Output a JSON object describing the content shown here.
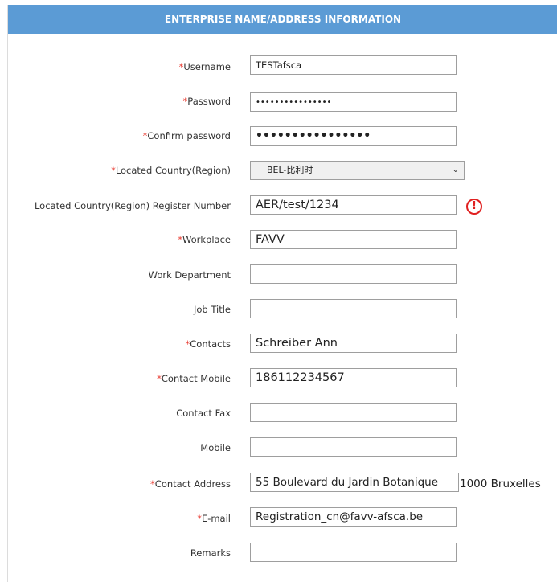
{
  "header": {
    "title": "ENTERPRISE NAME/ADDRESS INFORMATION"
  },
  "fields": {
    "username": {
      "label": "Username",
      "value": "TESTafsca"
    },
    "password": {
      "label": "Password",
      "value": "••••••••••••••••"
    },
    "confirm_password": {
      "label": "Confirm password",
      "value": "••••••••••••••••"
    },
    "country": {
      "label": "Located Country(Region)",
      "value": "BEL-比利时"
    },
    "register_number": {
      "label": "Located Country(Region) Register Number",
      "value": "AER/test/1234"
    },
    "workplace": {
      "label": "Workplace",
      "value": "FAVV"
    },
    "work_department": {
      "label": "Work Department",
      "value": ""
    },
    "job_title": {
      "label": "Job Title",
      "value": ""
    },
    "contacts": {
      "label": "Contacts",
      "value": "Schreiber Ann"
    },
    "contact_mobile": {
      "label": "Contact Mobile",
      "value": "186112234567"
    },
    "contact_fax": {
      "label": "Contact Fax",
      "value": ""
    },
    "mobile": {
      "label": "Mobile",
      "value": ""
    },
    "contact_address": {
      "label": "Contact Address",
      "value": "55 Boulevard du Jardin Botanique",
      "overflow": "1000 Bruxelles"
    },
    "email": {
      "label": "E-mail",
      "value": "Registration_cn@favv-afsca.be"
    },
    "remarks": {
      "label": "Remarks",
      "value": ""
    }
  },
  "required_mark": "*",
  "warning_icon": {
    "name": "exclamation-circle-icon",
    "glyph": "!",
    "color": "#e02020"
  },
  "colors": {
    "header_bg": "#5b9bd5",
    "required": "#e8382e"
  }
}
